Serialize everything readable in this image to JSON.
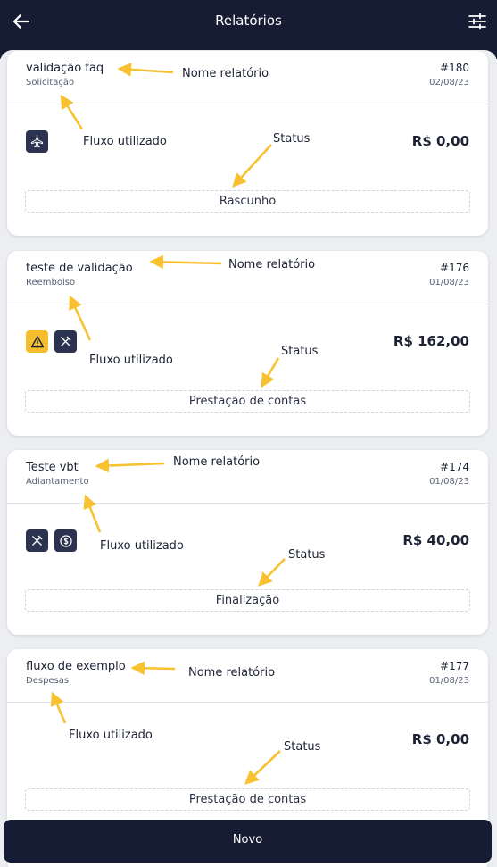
{
  "header": {
    "title": "Relatórios",
    "back_icon": "arrow-left-icon",
    "filter_icon": "sliders-icon"
  },
  "colors": {
    "header_bg": "#161c33",
    "list_bg": "#eceef2",
    "icon_bg": "#2c3350",
    "warning": "#f4be2c",
    "arrow": "#f7c130"
  },
  "reports": [
    {
      "name": "validação faq",
      "type": "Solicitação",
      "number": "#180",
      "date": "02/08/23",
      "value": "R$ 0,00",
      "status": "Rascunho",
      "icons": [
        "plane-icon"
      ]
    },
    {
      "name": "teste de validação",
      "type": "Reembolso",
      "number": "#176",
      "date": "01/08/23",
      "value": "R$ 162,00",
      "status": "Prestação de contas",
      "icons": [
        "warning-icon",
        "cutlery-icon"
      ]
    },
    {
      "name": "Teste vbt",
      "type": "Adiantamento",
      "number": "#174",
      "date": "01/08/23",
      "value": "R$ 40,00",
      "status": "Finalização",
      "icons": [
        "cutlery-icon",
        "coin-icon"
      ]
    },
    {
      "name": "fluxo de exemplo",
      "type": "Despesas",
      "number": "#177",
      "date": "01/08/23",
      "value": "R$ 0,00",
      "status": "Prestação de contas",
      "icons": []
    }
  ],
  "annotations": {
    "name_label": "Nome relatório",
    "flow_label": "Fluxo utilizado",
    "status_label": "Status"
  },
  "footer": {
    "new_button": "Novo"
  }
}
